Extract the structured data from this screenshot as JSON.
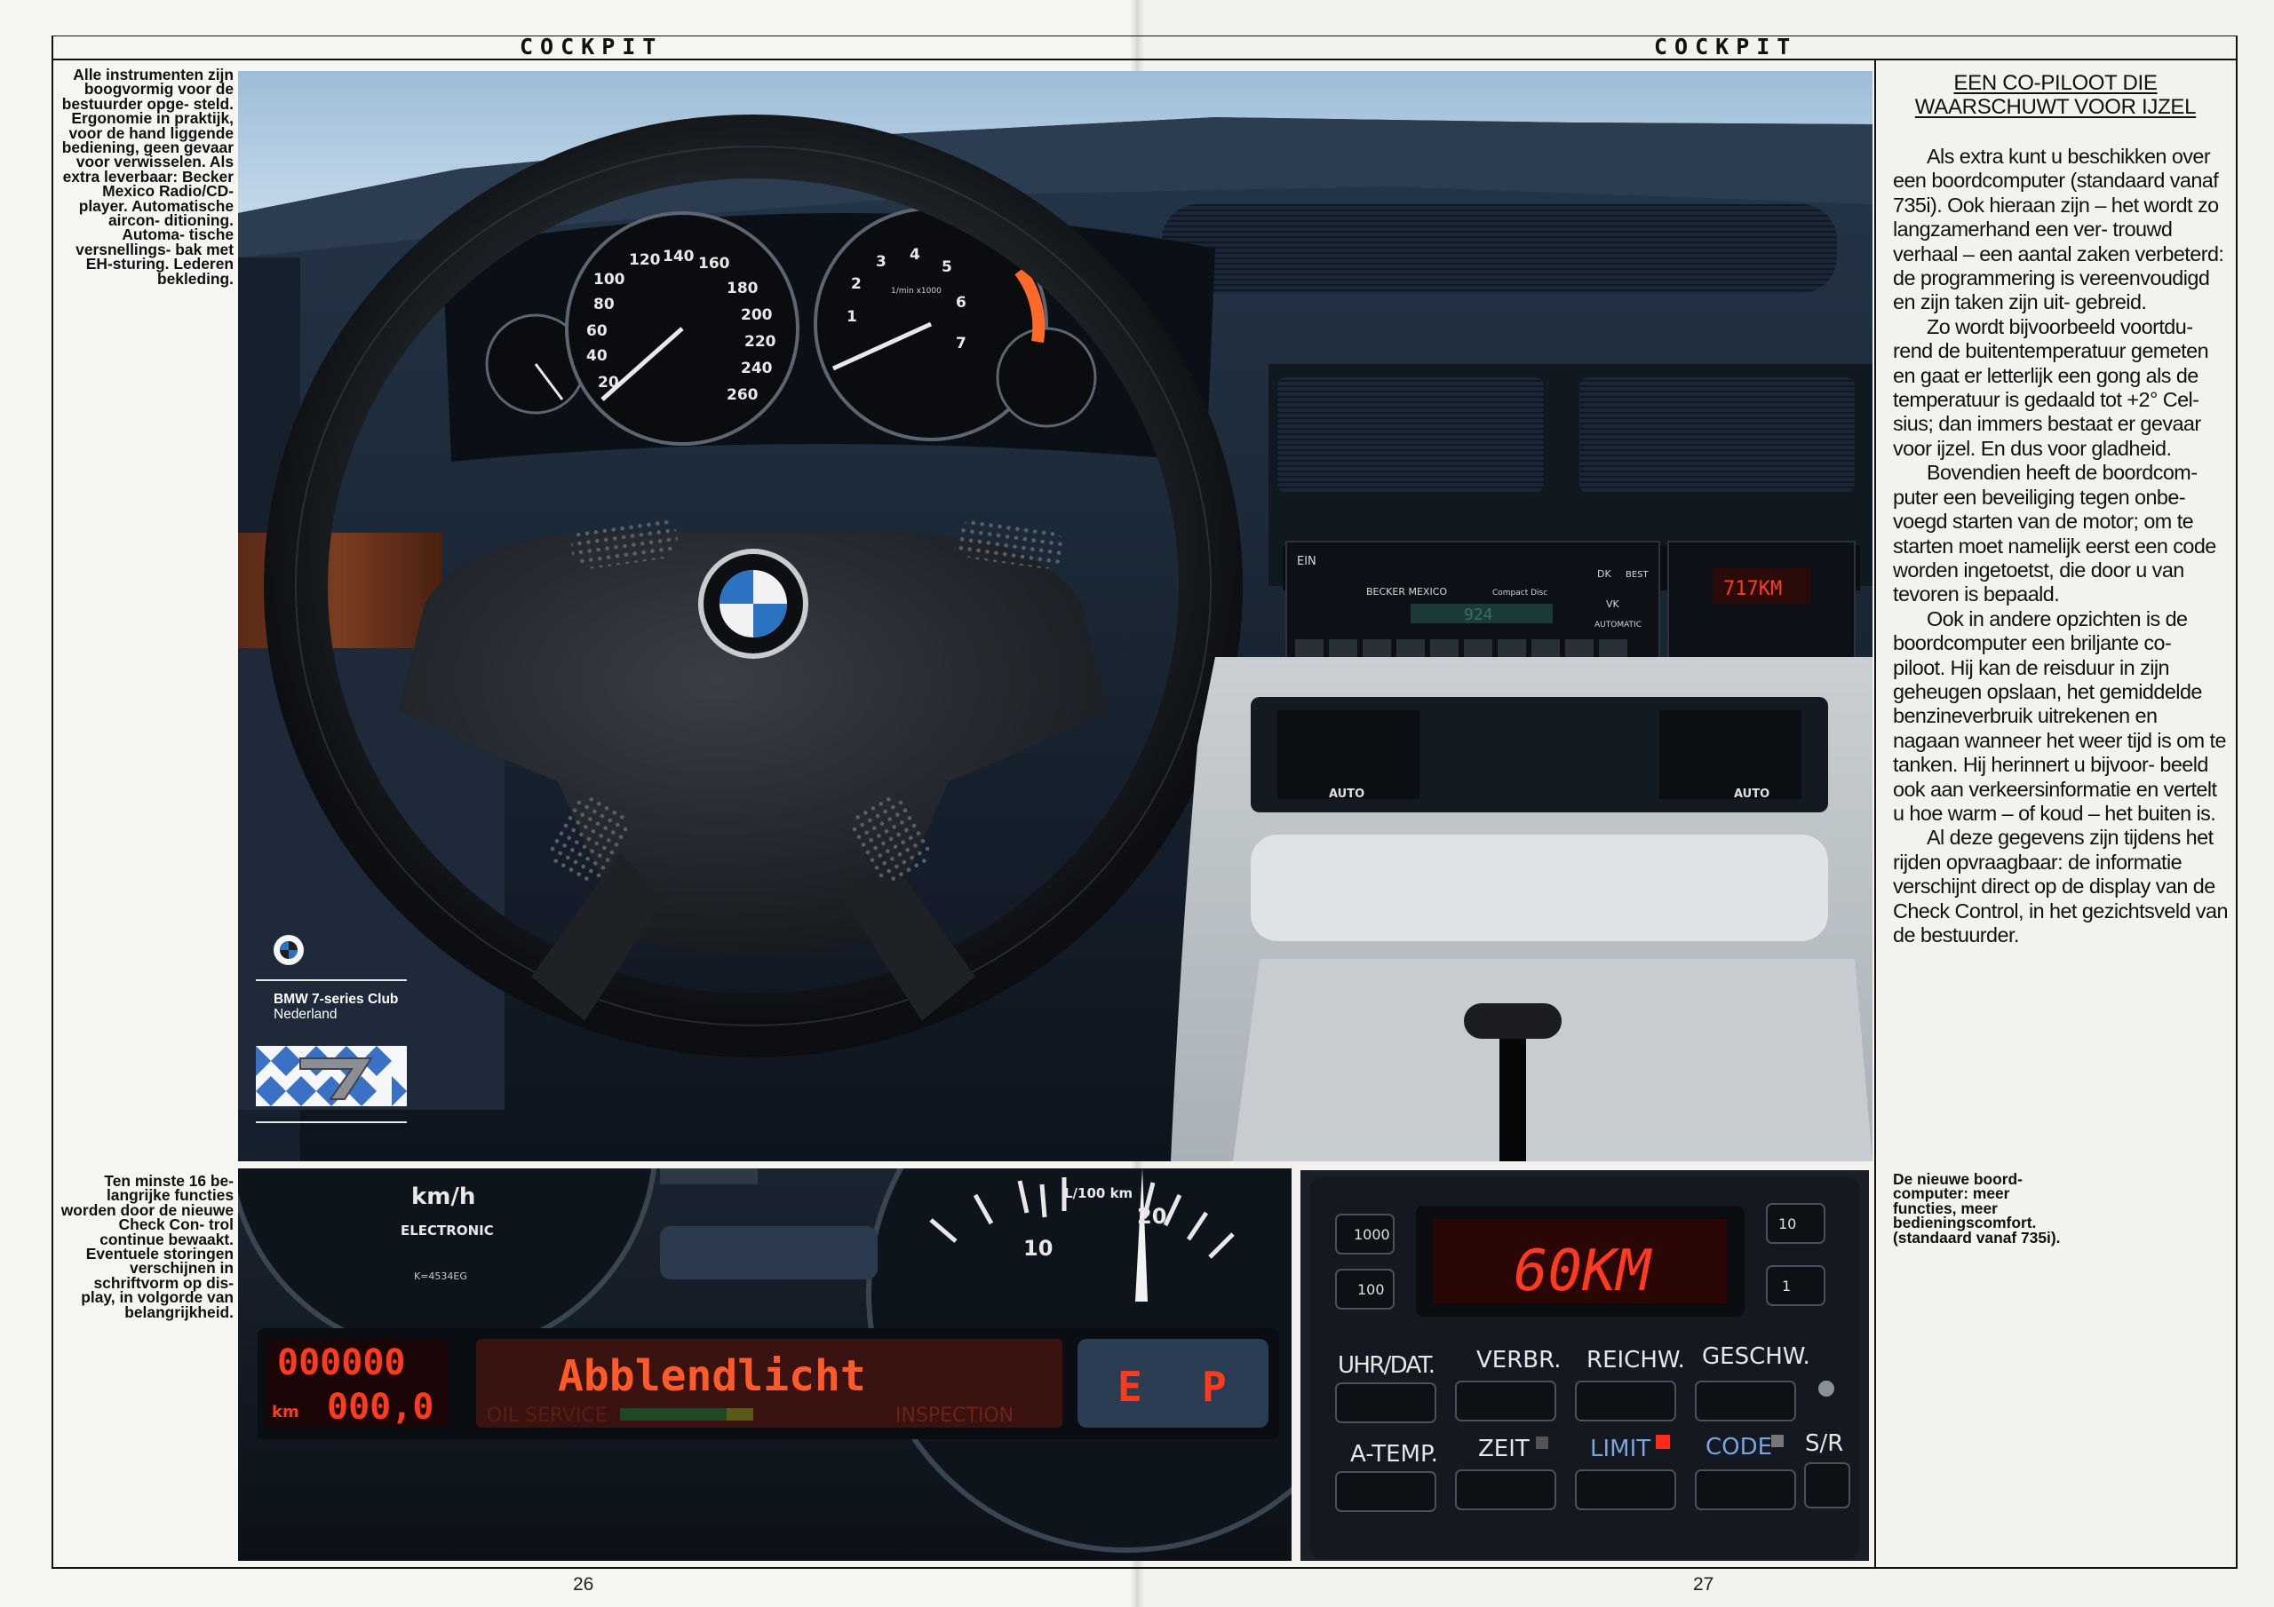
{
  "running_head_left": "COCKPIT",
  "running_head_right": "COCKPIT",
  "caption_top_left": "Alle instrumenten zijn boogvormig voor de bestuurder opge- steld. Ergonomie in praktijk, voor de hand liggende bediening, geen gevaar voor verwisselen. Als extra leverbaar: Becker Mexico Radio/CD-player. Automatische aircon- ditioning. Automa- tische versnellings- bak met EH-sturing. Lederen bekleding.",
  "caption_bottom_left": "Ten minste 16 be- langrijke functies worden door de nieuwe Check Con- trol continue bewaakt. Eventuele storingen verschijnen in schriftvorm op dis- play, in volgorde van belangrijkheid.",
  "caption_bottom_right": "De nieuwe boord- computer: meer functies, meer bedieningscomfort. (standaard vanaf 735i).",
  "page_number_left": "26",
  "page_number_right": "27",
  "club": {
    "line1": "BMW 7-series Club",
    "line2": "Nederland"
  },
  "headline": "EEN CO-PILOOT DIE WAARSCHUWT VOOR IJZEL",
  "body_paragraphs": [
    "Als extra kunt u beschikken over een boordcomputer (standaard vanaf 735i). Ook hieraan zijn – het wordt zo langzamerhand een ver- trouwd verhaal – een aantal zaken verbeterd: de programmering is vereenvoudigd en zijn taken zijn uit- gebreid.",
    "Zo wordt bijvoorbeeld voortdu- rend de buitentemperatuur gemeten en gaat er letterlijk een gong als de temperatuur is gedaald tot +2° Cel- sius; dan immers bestaat er gevaar voor ijzel. En dus voor gladheid.",
    "Bovendien heeft de boordcom- puter een beveiliging tegen onbe- voegd starten van de motor; om te starten moet namelijk eerst een code worden ingetoetst, die door u van tevoren is bepaald.",
    "Ook in andere opzichten is de boordcomputer een briljante co- piloot. Hij kan de reisduur in zijn geheugen opslaan, het gemiddelde benzineverbruik uitrekenen en nagaan wanneer het weer tijd is om te tanken. Hij herinnert u bijvoor- beeld ook aan verkeersinformatie en vertelt u hoe warm – of koud – het buiten is.",
    "Al deze gegevens zijn tijdens het rijden opvraagbaar: de informatie verschijnt direct op de display van de Check Control, in het gezichtsveld van de bestuurder."
  ],
  "cluster": {
    "speed_unit": "km/h",
    "speed_sub": "ELECTRONIC",
    "serial": "K=4534EG",
    "fuel_unit": "L/100 km",
    "fuel_10": "10",
    "fuel_20": "20",
    "odo_top": "000000",
    "odo_km": "km",
    "odo_bottom": "000,0",
    "message": "Abblendlicht",
    "service": "OIL SERVICE",
    "inspection": "INSPECTION",
    "gear_e": "E",
    "gear_p": "P",
    "speed_ticks": [
      "100",
      "120",
      "140",
      "160",
      "180",
      "200",
      "220",
      "240",
      "260",
      "80",
      "60",
      "40",
      "20"
    ],
    "rpm_ticks": [
      "1",
      "2",
      "3",
      "4",
      "5",
      "6",
      "7"
    ],
    "rpm_unit": "1/min x1000"
  },
  "computer": {
    "display": "60KM",
    "k1000": "1000",
    "k100": "100",
    "k10": "10",
    "k1": "1",
    "b_uhr": "UHR/DAT.",
    "b_verbr": "VERBR.",
    "b_reichw": "REICHW.",
    "b_geschw": "GESCHW.",
    "b_atemp": "A-TEMP.",
    "b_zeit": "ZEIT",
    "b_limit": "LIMIT",
    "b_code": "CODE",
    "b_sr": "S/R"
  },
  "console": {
    "radio_ein": "EIN",
    "radio_brand": "BECKER MEXICO",
    "radio_cd": "Compact Disc",
    "radio_best": "BEST",
    "radio_dk": "DK",
    "radio_vk": "VK",
    "radio_auto": "AUTOMATIC",
    "radio_freq": "924",
    "bc_display": "717KM",
    "ac_auto": "AUTO"
  },
  "colors": {
    "led_red": "#ff3a1f",
    "led_amber": "#ff6a2a",
    "sky": "#a9c6df",
    "dash_blue": "#1d2a3a"
  }
}
